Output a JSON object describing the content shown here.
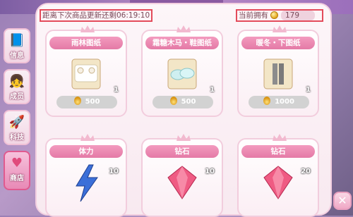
{
  "header": {
    "restock_timer": "距离下次商品更新还剩06:19:10",
    "owned_label": "当前拥有",
    "owned_value": "179"
  },
  "sidebar": {
    "items": [
      {
        "label": "信息",
        "icon": "info-book-icon",
        "active": false
      },
      {
        "label": "成员",
        "icon": "member-avatar-icon",
        "active": false
      },
      {
        "label": "科技",
        "icon": "rocket-icon",
        "active": false
      },
      {
        "label": "商店",
        "icon": "shop-bag-icon",
        "active": true
      }
    ]
  },
  "shop": {
    "items": [
      {
        "title": "雨林图纸",
        "icon": "scroll-blueprint-icon",
        "quantity": "1",
        "price": "500"
      },
      {
        "title": "霜糖木马・鞋图纸",
        "icon": "scroll-blueprint-icon",
        "quantity": "1",
        "price": "500"
      },
      {
        "title": "暖冬・下图纸",
        "icon": "scroll-blueprint-icon",
        "quantity": "1",
        "price": "1000"
      },
      {
        "title": "体力",
        "icon": "lightning-icon",
        "quantity": "10",
        "price": ""
      },
      {
        "title": "钻石",
        "icon": "diamond-icon",
        "quantity": "10",
        "price": ""
      },
      {
        "title": "钻石",
        "icon": "diamond-icon",
        "quantity": "20",
        "price": ""
      }
    ]
  },
  "colors": {
    "highlight_border": "#e34b5b",
    "title_pink": "#e47aa6",
    "price_gray": "#d2d2d2"
  }
}
